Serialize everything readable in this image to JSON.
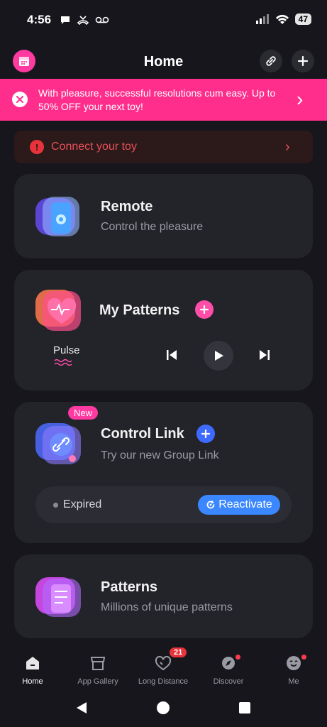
{
  "status": {
    "time": "4:56",
    "battery": "47"
  },
  "header": {
    "title": "Home"
  },
  "promo": {
    "text": "With pleasure, successful resolutions cum easy. Up to 50% OFF your next toy!"
  },
  "connect": {
    "label": "Connect your toy"
  },
  "remote": {
    "title": "Remote",
    "subtitle": "Control the pleasure"
  },
  "my_patterns": {
    "title": "My Patterns",
    "current": "Pulse"
  },
  "control_link": {
    "badge": "New",
    "title": "Control Link",
    "subtitle": "Try our new Group Link",
    "status": "Expired",
    "action": "Reactivate"
  },
  "patterns": {
    "title": "Patterns",
    "subtitle": "Millions of unique patterns"
  },
  "nav": {
    "items": [
      {
        "label": "Home",
        "icon": "home-icon"
      },
      {
        "label": "App Gallery",
        "icon": "store-icon"
      },
      {
        "label": "Long Distance",
        "icon": "heart-chat-icon",
        "badge": "21"
      },
      {
        "label": "Discover",
        "icon": "compass-icon"
      },
      {
        "label": "Me",
        "icon": "face-icon"
      }
    ]
  },
  "colors": {
    "accent_pink": "#ff2e8c",
    "accent_blue": "#3a87ff",
    "bg": "#16161c",
    "card": "#23232a"
  }
}
